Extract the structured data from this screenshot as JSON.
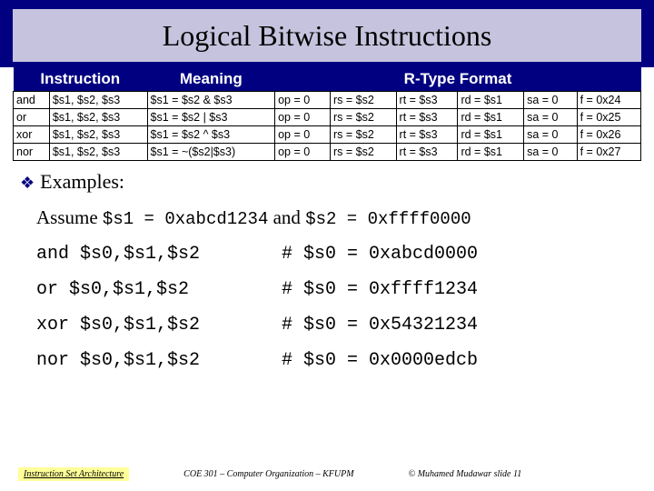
{
  "title": "Logical Bitwise Instructions",
  "table": {
    "headers": {
      "h1": "Instruction",
      "h2": "Meaning",
      "h3": "R-Type Format"
    },
    "rows": [
      {
        "op": "and",
        "args": "$s1, $s2, $s3",
        "meaning": "$s1 = $s2 & $s3",
        "opf": "op = 0",
        "rs": "rs = $s2",
        "rt": "rt = $s3",
        "rd": "rd = $s1",
        "sa": "sa = 0",
        "f": "f = 0x24"
      },
      {
        "op": "or",
        "args": "$s1, $s2, $s3",
        "meaning": "$s1 = $s2 | $s3",
        "opf": "op = 0",
        "rs": "rs = $s2",
        "rt": "rt = $s3",
        "rd": "rd = $s1",
        "sa": "sa = 0",
        "f": "f = 0x25"
      },
      {
        "op": "xor",
        "args": "$s1, $s2, $s3",
        "meaning": "$s1 = $s2 ^ $s3",
        "opf": "op = 0",
        "rs": "rs = $s2",
        "rt": "rt = $s3",
        "rd": "rd = $s1",
        "sa": "sa = 0",
        "f": "f = 0x26"
      },
      {
        "op": "nor",
        "args": "$s1, $s2, $s3",
        "meaning": "$s1 = ~($s2|$s3)",
        "opf": "op = 0",
        "rs": "rs = $s2",
        "rt": "rt = $s3",
        "rd": "rd = $s1",
        "sa": "sa = 0",
        "f": "f = 0x27"
      }
    ]
  },
  "examples_label": "Examples:",
  "assume_prefix": "Assume ",
  "assume_code1": "$s1 = 0xabcd1234",
  "assume_mid": " and ",
  "assume_code2": "$s2 = 0xffff0000",
  "code_examples": [
    {
      "left": "and $s0,$s1,$s2",
      "right": "# $s0 = 0xabcd0000"
    },
    {
      "left": "or  $s0,$s1,$s2",
      "right": "# $s0 = 0xffff1234"
    },
    {
      "left": "xor $s0,$s1,$s2",
      "right": "# $s0 = 0x54321234"
    },
    {
      "left": "nor $s0,$s1,$s2",
      "right": "# $s0 = 0x0000edcb"
    }
  ],
  "footer": {
    "left": "Instruction Set Architecture",
    "center": "COE 301 – Computer Organization – KFUPM",
    "right": "© Muhamed Mudawar   slide 11"
  }
}
